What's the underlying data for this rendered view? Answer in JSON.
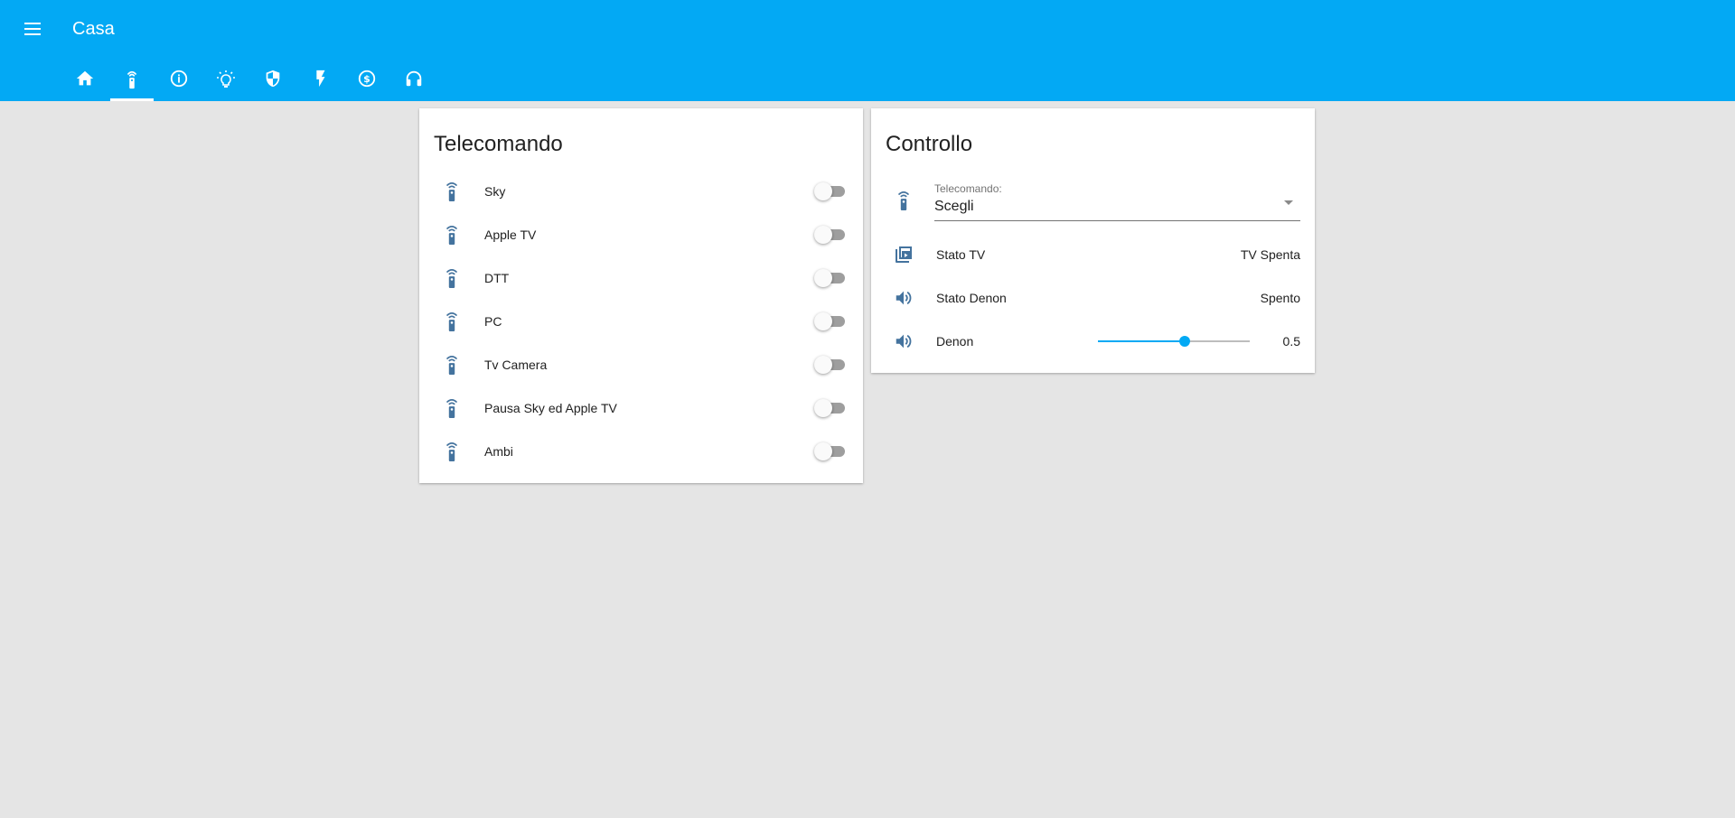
{
  "app": {
    "title": "Casa"
  },
  "tabs": [
    {
      "icon": "home-icon",
      "active": false
    },
    {
      "icon": "remote-icon",
      "active": true
    },
    {
      "icon": "info-icon",
      "active": false
    },
    {
      "icon": "lightbulb-icon",
      "active": false
    },
    {
      "icon": "shield-icon",
      "active": false
    },
    {
      "icon": "flash-icon",
      "active": false
    },
    {
      "icon": "currency-icon",
      "active": false
    },
    {
      "icon": "headphones-icon",
      "active": false
    }
  ],
  "telecomando": {
    "title": "Telecomando",
    "items": [
      {
        "label": "Sky",
        "on": false
      },
      {
        "label": "Apple TV",
        "on": false
      },
      {
        "label": "DTT",
        "on": false
      },
      {
        "label": "PC",
        "on": false
      },
      {
        "label": "Tv Camera",
        "on": false
      },
      {
        "label": "Pausa Sky ed Apple TV",
        "on": false
      },
      {
        "label": "Ambi",
        "on": false
      }
    ]
  },
  "controllo": {
    "title": "Controllo",
    "select": {
      "label": "Telecomando:",
      "value": "Scegli"
    },
    "stato_tv": {
      "label": "Stato TV",
      "value": "TV Spenta"
    },
    "stato_denon": {
      "label": "Stato Denon",
      "value": "Spento"
    },
    "denon": {
      "label": "Denon",
      "value": "0.5",
      "level": 0.57
    }
  },
  "colors": {
    "header": "#03a9f4",
    "icon": "#44739e",
    "accent": "#03a9f4",
    "background": "#e5e5e5"
  }
}
